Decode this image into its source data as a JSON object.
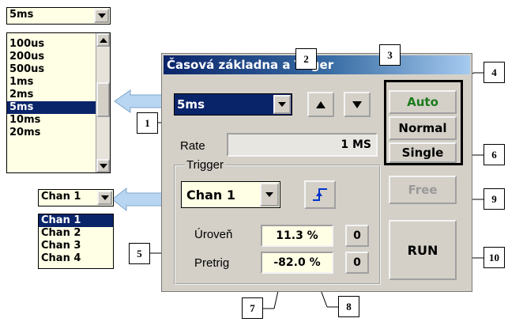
{
  "timebase_dropdown": {
    "selected": "5ms",
    "options": [
      "100us",
      "200us",
      "500us",
      "1ms",
      "2ms",
      "5ms",
      "10ms",
      "20ms"
    ],
    "selected_option": "5ms"
  },
  "channel_dropdown": {
    "selected": "Chan 1",
    "options": [
      "Chan 1",
      "Chan 2",
      "Chan 3",
      "Chan 4"
    ],
    "selected_option": "Chan 1"
  },
  "panel": {
    "title": "Časová základna a Triger",
    "timebase_value": "5ms",
    "rate_label": "Rate",
    "rate_value": "1 MS",
    "trigger_group_label": "Trigger",
    "trigger_channel": "Chan 1",
    "level_label": "Úroveň",
    "level_value": "11.3 %",
    "level_reset": "0",
    "pretrig_label": "Pretrig",
    "pretrig_value": "-82.0 %",
    "pretrig_reset": "0",
    "mode_buttons": [
      "Auto",
      "Normal",
      "Single"
    ],
    "free_label": "Free",
    "run_label": "RUN"
  },
  "callouts": [
    "1",
    "2",
    "3",
    "4",
    "5",
    "6",
    "7",
    "8",
    "9",
    "10"
  ],
  "colors": {
    "panel_bg": "#d4d0c8",
    "field_bg": "#ffffe6",
    "selection": "#0a246a",
    "auto_green": "#1a7a1a",
    "arrow": "#b8d6f2",
    "trigger_icon": "#0033cc"
  },
  "icons": {
    "trigger_slope": "rising-edge-trigger-icon",
    "up": "up-arrow-icon",
    "down": "down-arrow-icon"
  }
}
